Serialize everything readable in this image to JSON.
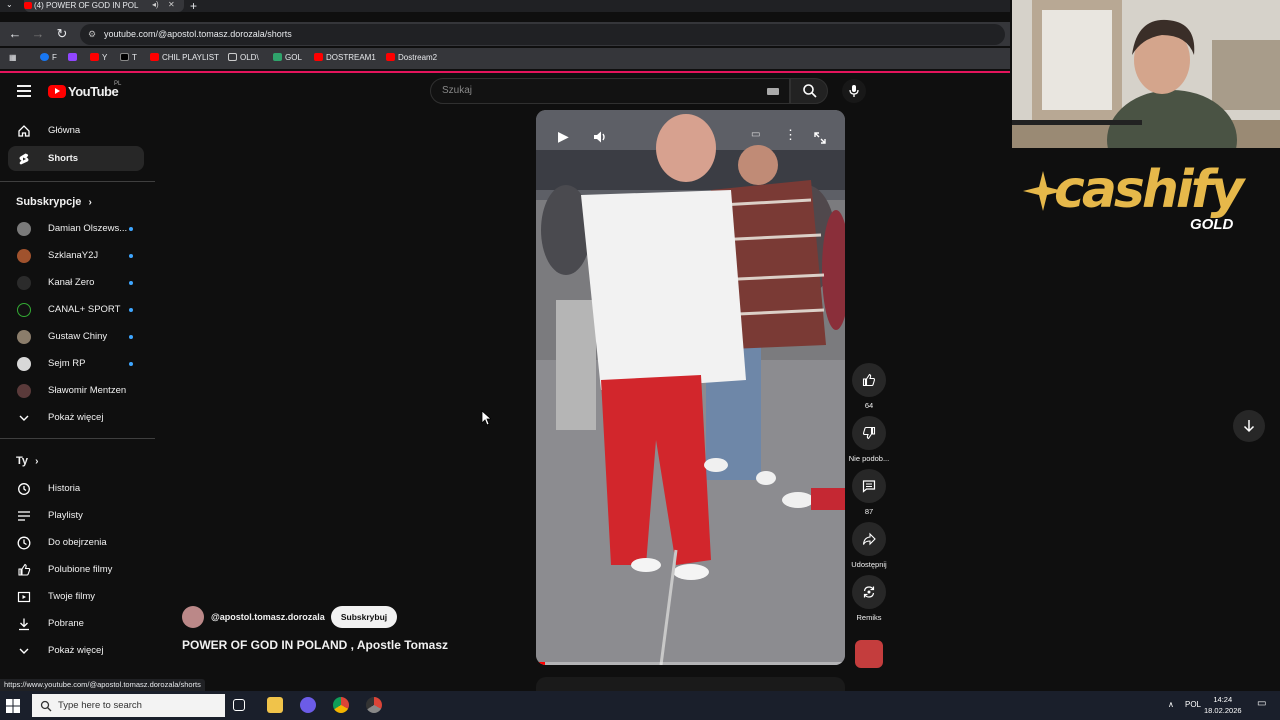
{
  "browser": {
    "tab_title": "(4) POWER OF GOD IN POL",
    "url": "youtube.com/@apostol.tomasz.dorozala/shorts",
    "bookmarks": [
      "F",
      "Y",
      "T",
      "CHIL PLAYLIST",
      "OLD\\",
      "GOL",
      "DOSTREAM1",
      "Dostream2"
    ],
    "status_url": "https://www.youtube.com/@apostol.tomasz.dorozala/shorts"
  },
  "youtube": {
    "logo_text": "YouTube",
    "region": "PL",
    "search_placeholder": "Szukaj"
  },
  "sidebar": {
    "main_items": [
      {
        "label": "Główna",
        "icon": "home-icon"
      },
      {
        "label": "Shorts",
        "icon": "shorts-icon",
        "active": true
      }
    ],
    "subscriptions_header": "Subskrypcje",
    "subscriptions": [
      {
        "label": "Damian Olszews...",
        "color": "#7a7a7a"
      },
      {
        "label": "SzklanaY2J",
        "color": "#a0522d"
      },
      {
        "label": "Kanał Zero",
        "color": "#2b2b2b"
      },
      {
        "label": "CANAL+ SPORT",
        "color": "#111111"
      },
      {
        "label": "Gustaw Chiny",
        "color": "#8b7d6b"
      },
      {
        "label": "Sejm RP",
        "color": "#d8d8d8"
      },
      {
        "label": "Sławomir Mentzen",
        "color": "#5a3a3a"
      }
    ],
    "show_more_1": "Pokaż więcej",
    "you_header": "Ty",
    "you_items": [
      {
        "label": "Historia",
        "icon": "history-icon"
      },
      {
        "label": "Playlisty",
        "icon": "playlists-icon"
      },
      {
        "label": "Do obejrzenia",
        "icon": "watch-later-icon"
      },
      {
        "label": "Polubione filmy",
        "icon": "liked-icon"
      },
      {
        "label": "Twoje filmy",
        "icon": "your-videos-icon"
      },
      {
        "label": "Pobrane",
        "icon": "download-icon"
      }
    ],
    "show_more_2": "Pokaż więcej"
  },
  "short": {
    "channel_handle": "@apostol.tomasz.dorozala",
    "subscribe_label": "Subskrybuj",
    "title": "POWER OF GOD IN POLAND , Apostle Tomasz",
    "progress": 0.03,
    "actions": {
      "likes": "64",
      "dislike": "Nie podob...",
      "comments": "87",
      "share": "Udostępnij",
      "remix": "Remiks"
    }
  },
  "overlay": {
    "brand_main": "cashify",
    "brand_sub": "GOLD"
  },
  "taskbar": {
    "search_placeholder": "Type here to search",
    "language": "POL",
    "time": "14:24",
    "date": "18.02.2026"
  }
}
